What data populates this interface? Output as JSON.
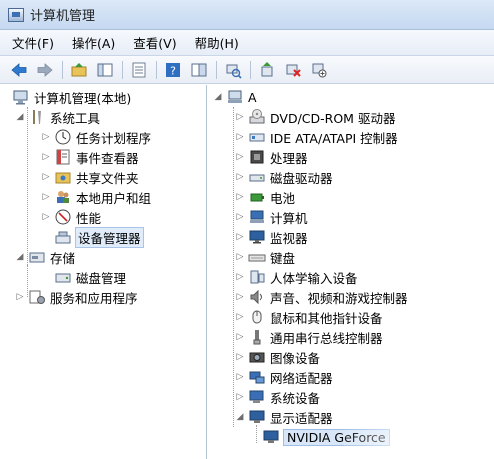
{
  "window": {
    "title": "计算机管理"
  },
  "menu": [
    "文件(F)",
    "操作(A)",
    "查看(V)",
    "帮助(H)"
  ],
  "left_tree": [
    {
      "label": "计算机管理(本地)",
      "level": 0,
      "expander": "none",
      "icon": "computer-management-icon"
    },
    {
      "label": "系统工具",
      "level": 1,
      "expander": "expanded",
      "icon": "system-tools-icon"
    },
    {
      "label": "任务计划程序",
      "level": 2,
      "expander": "collapsed",
      "icon": "clock-icon"
    },
    {
      "label": "事件查看器",
      "level": 2,
      "expander": "collapsed",
      "icon": "event-viewer-icon"
    },
    {
      "label": "共享文件夹",
      "level": 2,
      "expander": "collapsed",
      "icon": "shared-folder-icon"
    },
    {
      "label": "本地用户和组",
      "level": 2,
      "expander": "collapsed",
      "icon": "users-icon"
    },
    {
      "label": "性能",
      "level": 2,
      "expander": "collapsed",
      "icon": "performance-icon"
    },
    {
      "label": "设备管理器",
      "level": 2,
      "expander": "none",
      "icon": "device-manager-icon",
      "selected": true
    },
    {
      "label": "存储",
      "level": 1,
      "expander": "expanded",
      "icon": "storage-icon"
    },
    {
      "label": "磁盘管理",
      "level": 2,
      "expander": "none",
      "icon": "disk-management-icon"
    },
    {
      "label": "服务和应用程序",
      "level": 1,
      "expander": "collapsed",
      "icon": "services-icon"
    }
  ],
  "right_tree": {
    "root": "A",
    "items": [
      {
        "label": "DVD/CD-ROM 驱动器",
        "icon": "dvd-drive-icon"
      },
      {
        "label": "IDE ATA/ATAPI 控制器",
        "icon": "ide-controller-icon"
      },
      {
        "label": "处理器",
        "icon": "processor-icon"
      },
      {
        "label": "磁盘驱动器",
        "icon": "disk-drive-icon"
      },
      {
        "label": "电池",
        "icon": "battery-icon"
      },
      {
        "label": "计算机",
        "icon": "computer-icon"
      },
      {
        "label": "监视器",
        "icon": "monitor-icon"
      },
      {
        "label": "键盘",
        "icon": "keyboard-icon"
      },
      {
        "label": "人体学输入设备",
        "icon": "hid-icon"
      },
      {
        "label": "声音、视频和游戏控制器",
        "icon": "sound-icon"
      },
      {
        "label": "鼠标和其他指针设备",
        "icon": "mouse-icon"
      },
      {
        "label": "通用串行总线控制器",
        "icon": "usb-icon"
      },
      {
        "label": "图像设备",
        "icon": "imaging-icon"
      },
      {
        "label": "网络适配器",
        "icon": "network-adapter-icon"
      },
      {
        "label": "系统设备",
        "icon": "system-devices-icon"
      },
      {
        "label": "显示适配器",
        "icon": "display-adapter-icon",
        "expanded": true
      }
    ],
    "child": {
      "label": "NVIDIA GeForce",
      "icon": "display-adapter-icon"
    }
  }
}
